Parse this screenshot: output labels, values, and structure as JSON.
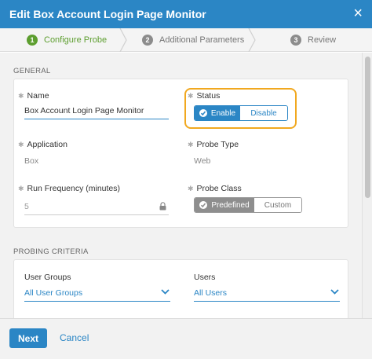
{
  "dialog": {
    "title": "Edit Box Account Login Page Monitor",
    "close_glyph": "×"
  },
  "wizard": {
    "steps": [
      {
        "number": "1",
        "label": "Configure Probe",
        "state": "active"
      },
      {
        "number": "2",
        "label": "Additional Parameters",
        "state": "pending"
      },
      {
        "number": "3",
        "label": "Review",
        "state": "pending"
      }
    ]
  },
  "general": {
    "section_label": "GENERAL",
    "name": {
      "label": "Name",
      "value": "Box Account Login Page Monitor"
    },
    "status": {
      "label": "Status",
      "options": [
        "Enable",
        "Disable"
      ],
      "selected": "Enable"
    },
    "application": {
      "label": "Application",
      "value": "Box"
    },
    "probe_type": {
      "label": "Probe Type",
      "value": "Web"
    },
    "run_frequency": {
      "label": "Run Frequency (minutes)",
      "value": "5",
      "locked_icon": "lock-icon"
    },
    "probe_class": {
      "label": "Probe Class",
      "options": [
        "Predefined",
        "Custom"
      ],
      "selected": "Predefined"
    }
  },
  "probing_criteria": {
    "section_label": "PROBING CRITERIA",
    "user_groups": {
      "label": "User Groups",
      "value": "All User Groups"
    },
    "users": {
      "label": "Users",
      "value": "All Users"
    }
  },
  "footer": {
    "next_label": "Next",
    "cancel_label": "Cancel"
  },
  "colors": {
    "primary": "#2b86c5",
    "success": "#5d9e2f",
    "highlight": "#f1a81f"
  }
}
